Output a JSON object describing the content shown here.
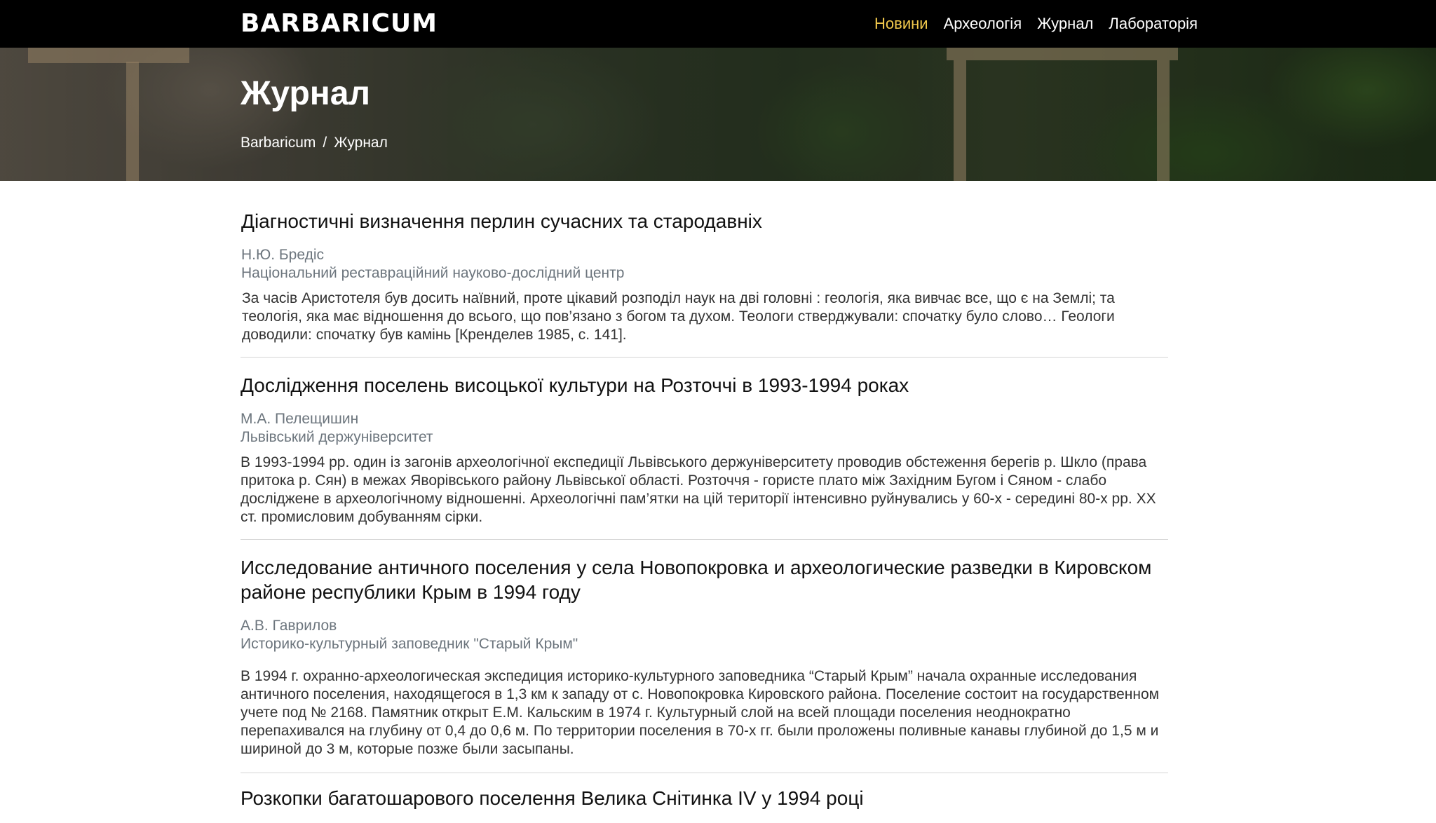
{
  "navbar": {
    "brand": "BARBARICUM",
    "items": [
      {
        "label": "Новини",
        "active": true
      },
      {
        "label": "Археологія",
        "active": false
      },
      {
        "label": "Журнал",
        "active": false
      },
      {
        "label": "Лабораторія",
        "active": false
      }
    ],
    "active_color": "#f2c94c"
  },
  "hero": {
    "title": "Журнал",
    "breadcrumb": [
      "Barbaricum",
      "/",
      "Журнал"
    ]
  },
  "articles": [
    {
      "title": "Діагностичні визначення перлин сучасних та стародавніх",
      "author": "Н.Ю. Бредіс",
      "affiliation": "Національний реставраційний науково-дослідний центр",
      "abstract": "За часів Аристотеля був досить наївний, проте цікавий розподіл наук на дві головні : геологія, яка вивчає все, що є на Землі; та теологія, яка має відношення до всього, що пов’язано з богом та духом. Теологи стверджували: спочатку було слово… Геологи доводили: спочатку був камінь [Кренделев 1985, с. 141]."
    },
    {
      "title": "Дослідження поселень висоцької культури на Розточчі в 1993-1994 роках",
      "author": "М.А. Пелещишин",
      "affiliation": "Львівський держуніверситет",
      "abstract": "В 1993-1994 рр. один із загонів археологічної експедиції Львівського держуніверситету проводив обстеження берегів р. Шкло (права притока р. Сян) в межах Яворівського району Львівської області. Розточчя - гористе плато між Західним Бугом і Сяном - слабо досліджене в археологічному відношенні. Археологічні пам’ятки на цій території інтенсивно руйнувались у 60-х - середині 80-х рр. ХХ ст. промисловим добуванням сірки."
    },
    {
      "title": "Исследование античного поселения у села Новопокровка и археологические разведки в Кировском районе республики Крым в 1994 году",
      "author": "А.В. Гаврилов",
      "affiliation": "Историко-культурный заповедник \"Старый Крым\"",
      "abstract": "В 1994 г. охранно-археологическая экспедиция историко-культурного заповедника “Старый Крым” начала охранные исследования античного поселения, находящегося в 1,3 км к западу от с. Новопокровка Кировского района. Поселение состоит на государственном учете под № 2168. Памятник открыт Е.М. Кальским в 1974 г. Культурный слой на всей площади поселения неоднократно перепахивался на глубину от 0,4 до 0,6 м. По территории поселения в 70-х гг. были проложены поливные канавы глубиной до 1,5 м и шириной до 3 м, которые позже были засыпаны."
    },
    {
      "title": "Розкопки багатошарового поселення Велика Снітинка IV у 1994 році",
      "author": "",
      "affiliation": "",
      "abstract": ""
    }
  ]
}
